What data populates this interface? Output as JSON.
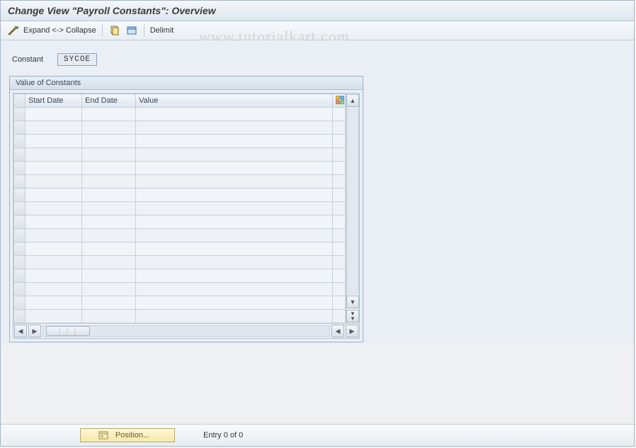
{
  "title": "Change View \"Payroll Constants\": Overview",
  "toolbar": {
    "expand_collapse_label": "Expand <-> Collapse",
    "delimit_label": "Delimit"
  },
  "field": {
    "label": "Constant",
    "value": "SYCOE"
  },
  "group": {
    "title": "Value of Constants",
    "columns": {
      "c1": "Start Date",
      "c2": "End Date",
      "c3": "Value"
    },
    "row_count": 16
  },
  "footer": {
    "position_label": "Position...",
    "entry_text": "Entry 0 of 0"
  },
  "watermark": "www.tutorialkart.com"
}
